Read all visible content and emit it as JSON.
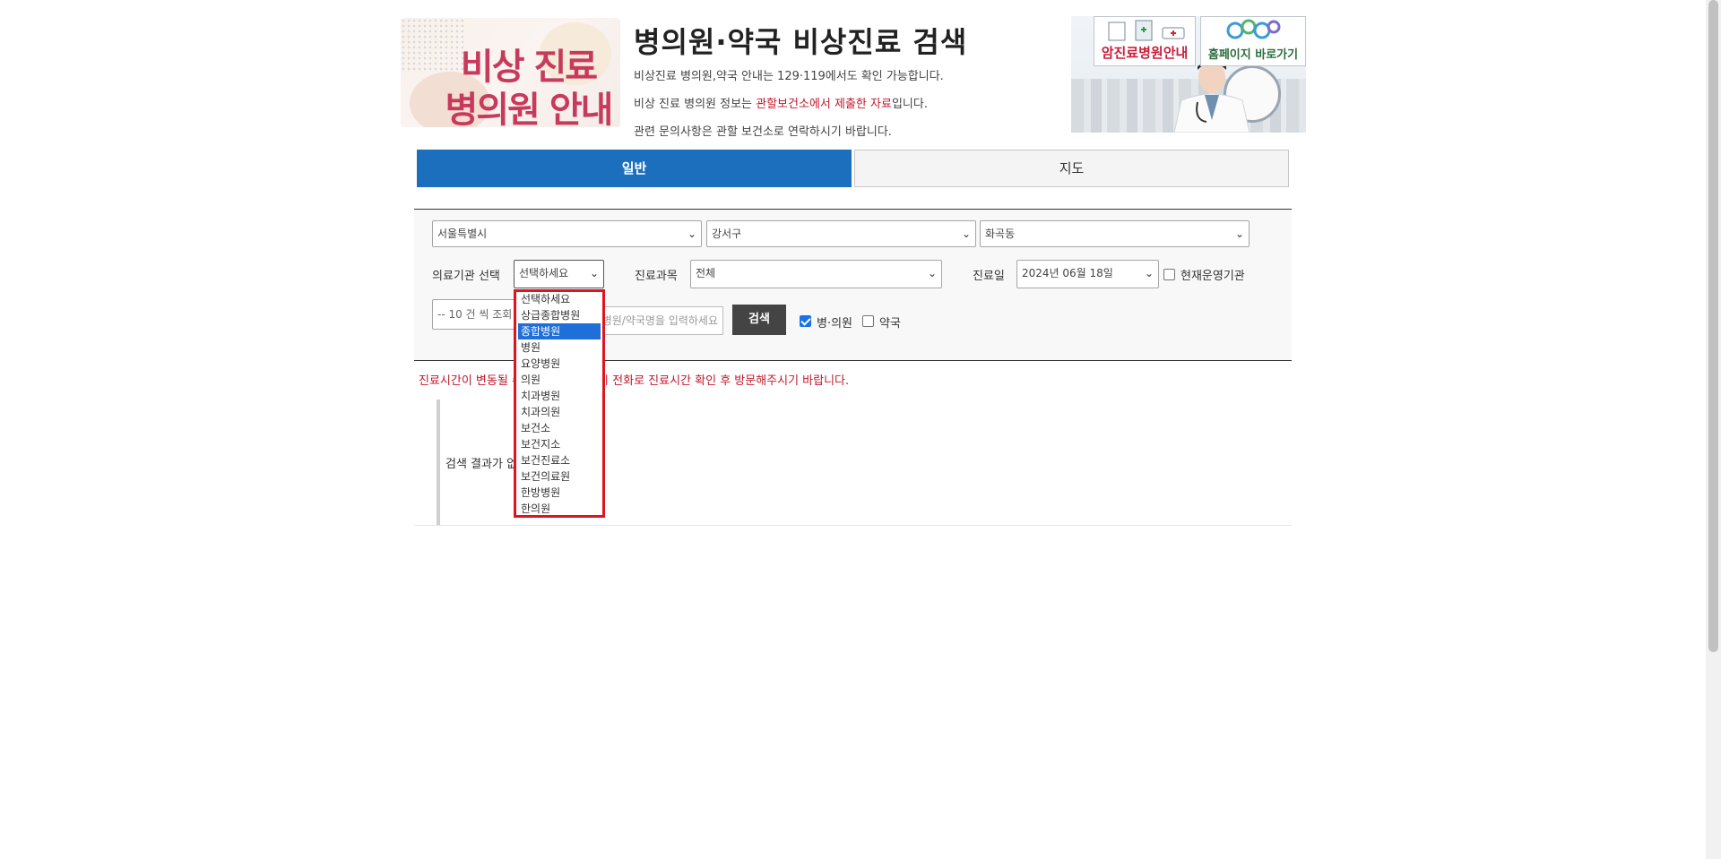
{
  "header": {
    "banner_line1": "비상 진료",
    "banner_line2": "병의원 안내",
    "title": "병의원·약국 비상진료 검색",
    "info1": "비상진료 병의원,약국 안내는 129·119에서도 확인 가능합니다.",
    "info2_before": "비상 진료 병의원 정보는 ",
    "info2_red": "관할보건소에서 제출한 자료",
    "info2_after": "입니다.",
    "info3": "관련 문의사항은 관할 보건소로 연락하시기 바랍니다.",
    "cancer_banner": "암진료병원안내",
    "home_banner": "홈페이지 바로가기"
  },
  "tabs": {
    "general": "일반",
    "map": "지도"
  },
  "search": {
    "city": "서울특별시",
    "district": "강서구",
    "dong": "화곡동",
    "institution_label": "의료기관 선택",
    "institution_value": "선택하세요",
    "department_label": "진료과목",
    "department_value": "전체",
    "date_label": "진료일",
    "date_value": "2024년 06월 18일",
    "currently_open_label": "현재운영기관",
    "per_page_value": "-- 10 건 씩 조회",
    "name_placeholder": "병원/약국명을 입력하세요",
    "search_button": "검색",
    "hospital_label": "병·의원",
    "pharmacy_label": "약국"
  },
  "notice": "진료시간이 변동될 수 있으므로 방문 시 전화로 진료시간 확인 후 방문해주시기 바랍니다.",
  "results": {
    "empty_message": "검색 결과가 없습니다."
  },
  "dropdown": {
    "options": [
      "선택하세요",
      "상급종합병원",
      "종합병원",
      "병원",
      "요양병원",
      "의원",
      "치과병원",
      "치과의원",
      "보건소",
      "보건지소",
      "보건진료소",
      "보건의료원",
      "한방병원",
      "한의원"
    ],
    "highlighted": "종합병원"
  },
  "colors": {
    "tab_active": "#1c6fbd",
    "red_text": "#c0172b",
    "dropdown_border": "#e0141e",
    "highlight": "#1e6fd9"
  }
}
